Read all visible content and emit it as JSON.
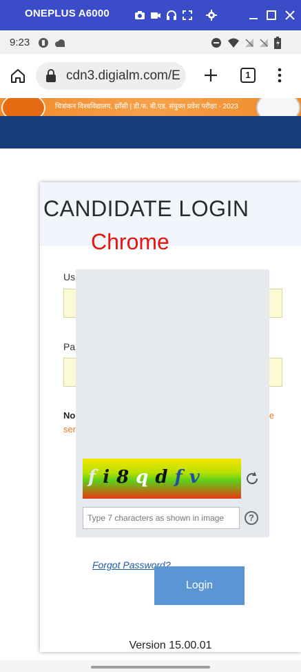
{
  "window": {
    "title": "ONEPLUS A6000"
  },
  "status_bar": {
    "time": "9:23"
  },
  "browser": {
    "url": "cdn3.digialm.com/E",
    "tab_count": "1"
  },
  "banner": {
    "text": "चित्रांकन विश्वविद्यालय, झाँसी  |  डी.फ. बी.एड. संयुक्त प्रवेश परीक्षा - 2023"
  },
  "login": {
    "title": "CANDIDATE LOGIN",
    "username_label": "Us",
    "password_label": "Pa",
    "note_left": "No",
    "note_left2": "ser",
    "note_right": "le",
    "forgot_password": "Forgot Password?",
    "login_button": "Login",
    "version": "Version 15.00.01"
  },
  "overlay": {
    "chrome_label": "Chrome",
    "captcha_chars": [
      "f",
      "i",
      "8",
      "q",
      "d",
      "f",
      "v"
    ],
    "captcha_colors": [
      "#e8e8e8",
      "#1a1a1a",
      "#111111",
      "#ffffff",
      "#111111",
      "#1f4fa0",
      "#1f4fa0"
    ],
    "captcha_placeholder": "Type 7 characters as shown in image"
  }
}
